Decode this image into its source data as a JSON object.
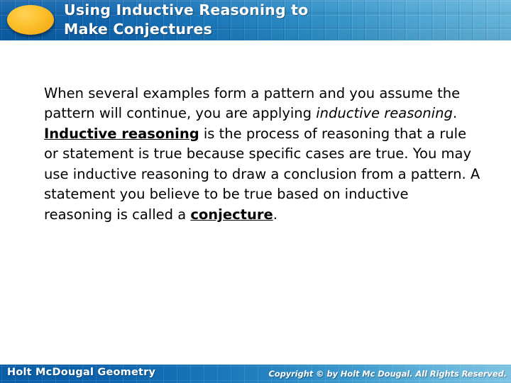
{
  "slide": {
    "header": {
      "title": "Using Inductive Reasoning to\nMake Conjectures",
      "title_line1": "Using Inductive Reasoning to",
      "title_line2": "Make Conjectures",
      "bullet_icon": "yellow-ellipse-bullet-icon",
      "band_color_left": "#0b5ea8",
      "band_color_right": "#63b4db",
      "bullet_color": "#f5b01b"
    },
    "body": {
      "segments": {
        "s1": "When several examples form a pattern and you assume the pattern will continue, you are applying ",
        "s2_italic": "inductive reasoning",
        "s3": ". ",
        "s4_bold_underline": "Inductive reasoning",
        "s5": " is the process of reasoning that a rule or statement is true because specific cases are true. You may use inductive reasoning to draw a conclusion from a pattern. A statement you believe to be true based on inductive reasoning is called a ",
        "s6_bold_underline": "conjecture",
        "s7": "."
      },
      "text_color": "#000000"
    },
    "footer": {
      "left_label": "Holt McDougal Geometry",
      "right_label": "Copyright © by Holt Mc Dougal. All Rights Reserved.",
      "band_color_left": "#0a5da7",
      "band_color_right": "#7cc2e2"
    }
  }
}
